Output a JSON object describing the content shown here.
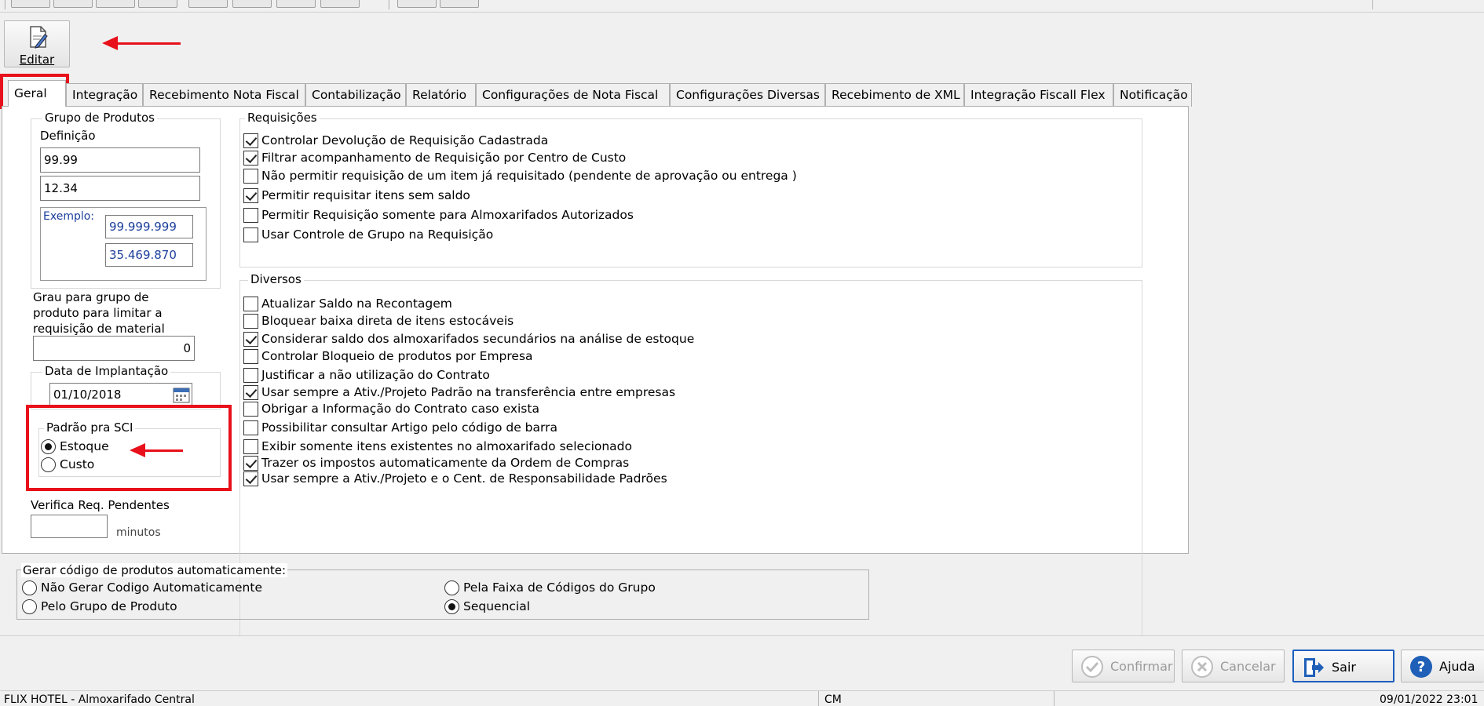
{
  "window": {
    "edit_label": "Editar"
  },
  "tabs": [
    {
      "label": "Geral",
      "active": true
    },
    {
      "label": "Integração"
    },
    {
      "label": "Recebimento Nota Fiscal"
    },
    {
      "label": "Contabilização"
    },
    {
      "label": "Relatório"
    },
    {
      "label": "Configurações de Nota Fiscal"
    },
    {
      "label": "Configurações Diversas"
    },
    {
      "label": "Recebimento de XML"
    },
    {
      "label": "Integração Fiscall Flex"
    },
    {
      "label": "Notificação"
    }
  ],
  "grupo_produtos": {
    "title": "Grupo de Produtos",
    "definicao_label": "Definição",
    "definicao_1": "99.99",
    "definicao_2": "12.34",
    "exemplo_label": "Exemplo:",
    "exemplo_1": "99.999.999",
    "exemplo_2": "35.469.870"
  },
  "grau": {
    "label_line1": "Grau para grupo de",
    "label_line2": "produto para limitar a",
    "label_line3": "requisição de material",
    "value": "0"
  },
  "data_implantacao": {
    "title": "Data de Implantação",
    "value": "01/10/2018"
  },
  "padrao_sci": {
    "title": "Padrão pra SCI",
    "options": [
      {
        "label": "Estoque",
        "selected": true
      },
      {
        "label": "Custo",
        "selected": false
      }
    ]
  },
  "verifica": {
    "label": "Verifica Req. Pendentes",
    "value": "",
    "unit": "minutos"
  },
  "requisicoes": {
    "title": "Requisições",
    "items": [
      {
        "label": "Controlar Devolução de Requisição Cadastrada",
        "checked": true
      },
      {
        "label": "Filtrar acompanhamento de Requisição por Centro de Custo",
        "checked": true
      },
      {
        "label": "Não permitir requisição de um item já requisitado (pendente de aprovação ou entrega )",
        "checked": false
      },
      {
        "label": "Permitir requisitar itens sem saldo",
        "checked": true
      },
      {
        "label": "Permitir Requisição somente para Almoxarifados Autorizados",
        "checked": false
      },
      {
        "label": "Usar Controle de Grupo na Requisição",
        "checked": false
      }
    ]
  },
  "diversos": {
    "title": "Diversos",
    "items": [
      {
        "label": "Atualizar Saldo na Recontagem",
        "checked": false
      },
      {
        "label": "Bloquear baixa direta de itens estocáveis",
        "checked": false
      },
      {
        "label": "Considerar saldo dos almoxarifados secundários na análise de estoque",
        "checked": true
      },
      {
        "label": "Controlar Bloqueio de produtos por Empresa",
        "checked": false
      },
      {
        "label": "Justificar a não utilização do Contrato",
        "checked": false
      },
      {
        "label": "Usar sempre a Ativ./Projeto Padrão na transferência entre empresas",
        "checked": true
      },
      {
        "label": "Obrigar a Informação do Contrato caso exista",
        "checked": false
      },
      {
        "label": "Possibilitar consultar Artigo pelo código de barra",
        "checked": false
      },
      {
        "label": "Exibir somente itens existentes no almoxarifado selecionado",
        "checked": false
      },
      {
        "label": "Trazer os impostos automaticamente da Ordem de Compras",
        "checked": true
      },
      {
        "label": "Usar sempre a Ativ./Projeto e o Cent. de Responsabilidade Padrões",
        "checked": true
      }
    ]
  },
  "gerar_codigo": {
    "title": "Gerar código de produtos automaticamente:",
    "options": [
      {
        "label": "Não Gerar Codigo Automaticamente",
        "selected": false
      },
      {
        "label": "Pelo Grupo de Produto",
        "selected": false
      },
      {
        "label": "Pela Faixa de Códigos do Grupo",
        "selected": false
      },
      {
        "label": "Sequencial",
        "selected": true
      }
    ]
  },
  "buttons": {
    "confirmar": "Confirmar",
    "cancelar": "Cancelar",
    "sair": "Sair",
    "ajuda": "Ajuda"
  },
  "status": {
    "left": "FLIX HOTEL - Almoxarifado Central",
    "middle": "CM",
    "right": "09/01/2022 23:01"
  },
  "colors": {
    "highlight": "#e8101a",
    "focus": "#1d5fbf",
    "help": "#1f5fb8"
  }
}
